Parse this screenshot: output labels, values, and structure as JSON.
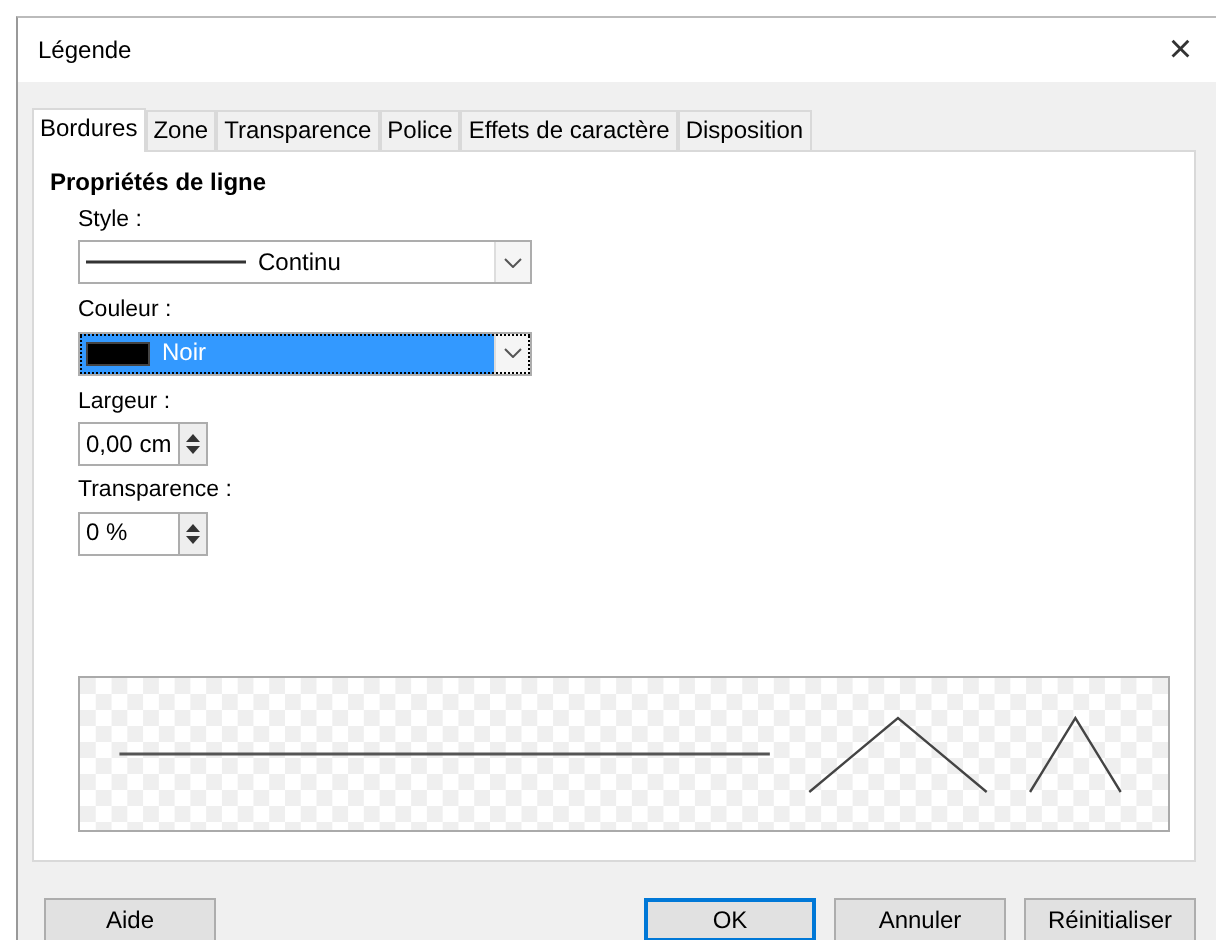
{
  "window": {
    "title": "Légende",
    "close": "×"
  },
  "tabs": [
    {
      "label": "Bordures",
      "selected": true
    },
    {
      "label": "Zone",
      "selected": false
    },
    {
      "label": "Transparence",
      "selected": false
    },
    {
      "label": "Police",
      "selected": false
    },
    {
      "label": "Effets de caractère",
      "selected": false
    },
    {
      "label": "Disposition",
      "selected": false
    }
  ],
  "section": {
    "title": "Propriétés de ligne"
  },
  "style": {
    "label": "Style :",
    "value": "Continu"
  },
  "color": {
    "label": "Couleur :",
    "value": "Noir",
    "color": "#000000",
    "focused": true
  },
  "width": {
    "label": "Largeur :",
    "value": "0,00 cm"
  },
  "transparency": {
    "label": "Transparence :",
    "value": "0 %"
  },
  "buttons": [
    {
      "label": "Aide",
      "default": false
    },
    {
      "label": "OK",
      "default": true
    },
    {
      "label": "Annuler",
      "default": false
    },
    {
      "label": "Réinitialiser",
      "default": false
    }
  ]
}
